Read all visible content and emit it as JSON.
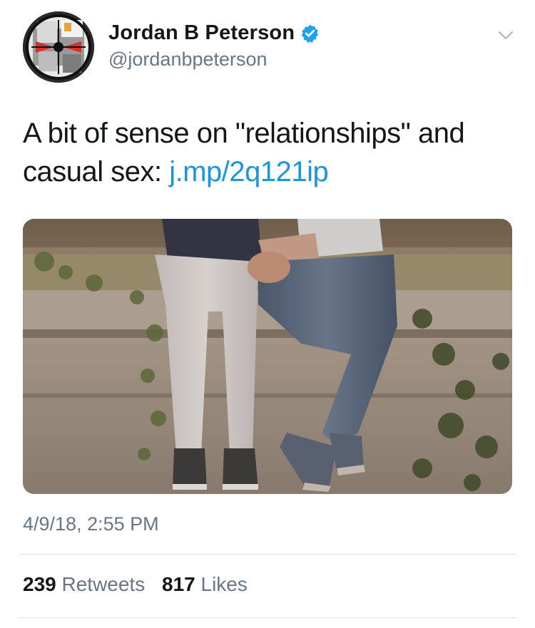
{
  "author": {
    "display_name": "Jordan B Peterson",
    "handle": "@jordanbpeterson",
    "verified": true,
    "avatar_icon": "maze-of-meaning-logo-avatar"
  },
  "tweet": {
    "text_before_link": "A bit of sense on \"relationships\" and casual sex: ",
    "link_text": "j.mp/2q121ip",
    "timestamp": "4/9/18, 2:55 PM"
  },
  "stats": {
    "retweets_count": "239",
    "retweets_label": "Retweets",
    "likes_count": "817",
    "likes_label": "Likes"
  },
  "colors": {
    "link": "#1b95e0",
    "secondary_text": "#657786",
    "verified_badge": "#1da1f2"
  },
  "icons": {
    "verified": "verified-badge-icon",
    "menu": "chevron-down-icon"
  }
}
